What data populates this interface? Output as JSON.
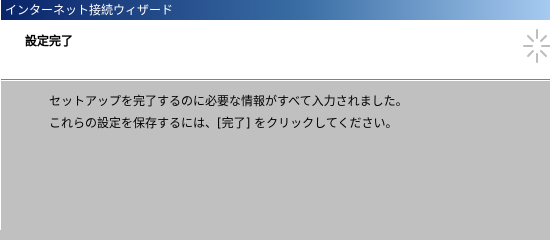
{
  "window": {
    "title": "インターネット接続ウィザード"
  },
  "header": {
    "title": "設定完了",
    "icon": "wizard-sparkle-icon"
  },
  "content": {
    "line1": "セットアップを完了するのに必要な情報がすべて入力されました。",
    "line2": "これらの設定を保存するには、[完了] をクリックしてください。"
  },
  "colors": {
    "titlebar_start": "#0a246a",
    "titlebar_end": "#a6caf0",
    "header_bg": "#ffffff",
    "body_bg": "#c0c0c0"
  }
}
